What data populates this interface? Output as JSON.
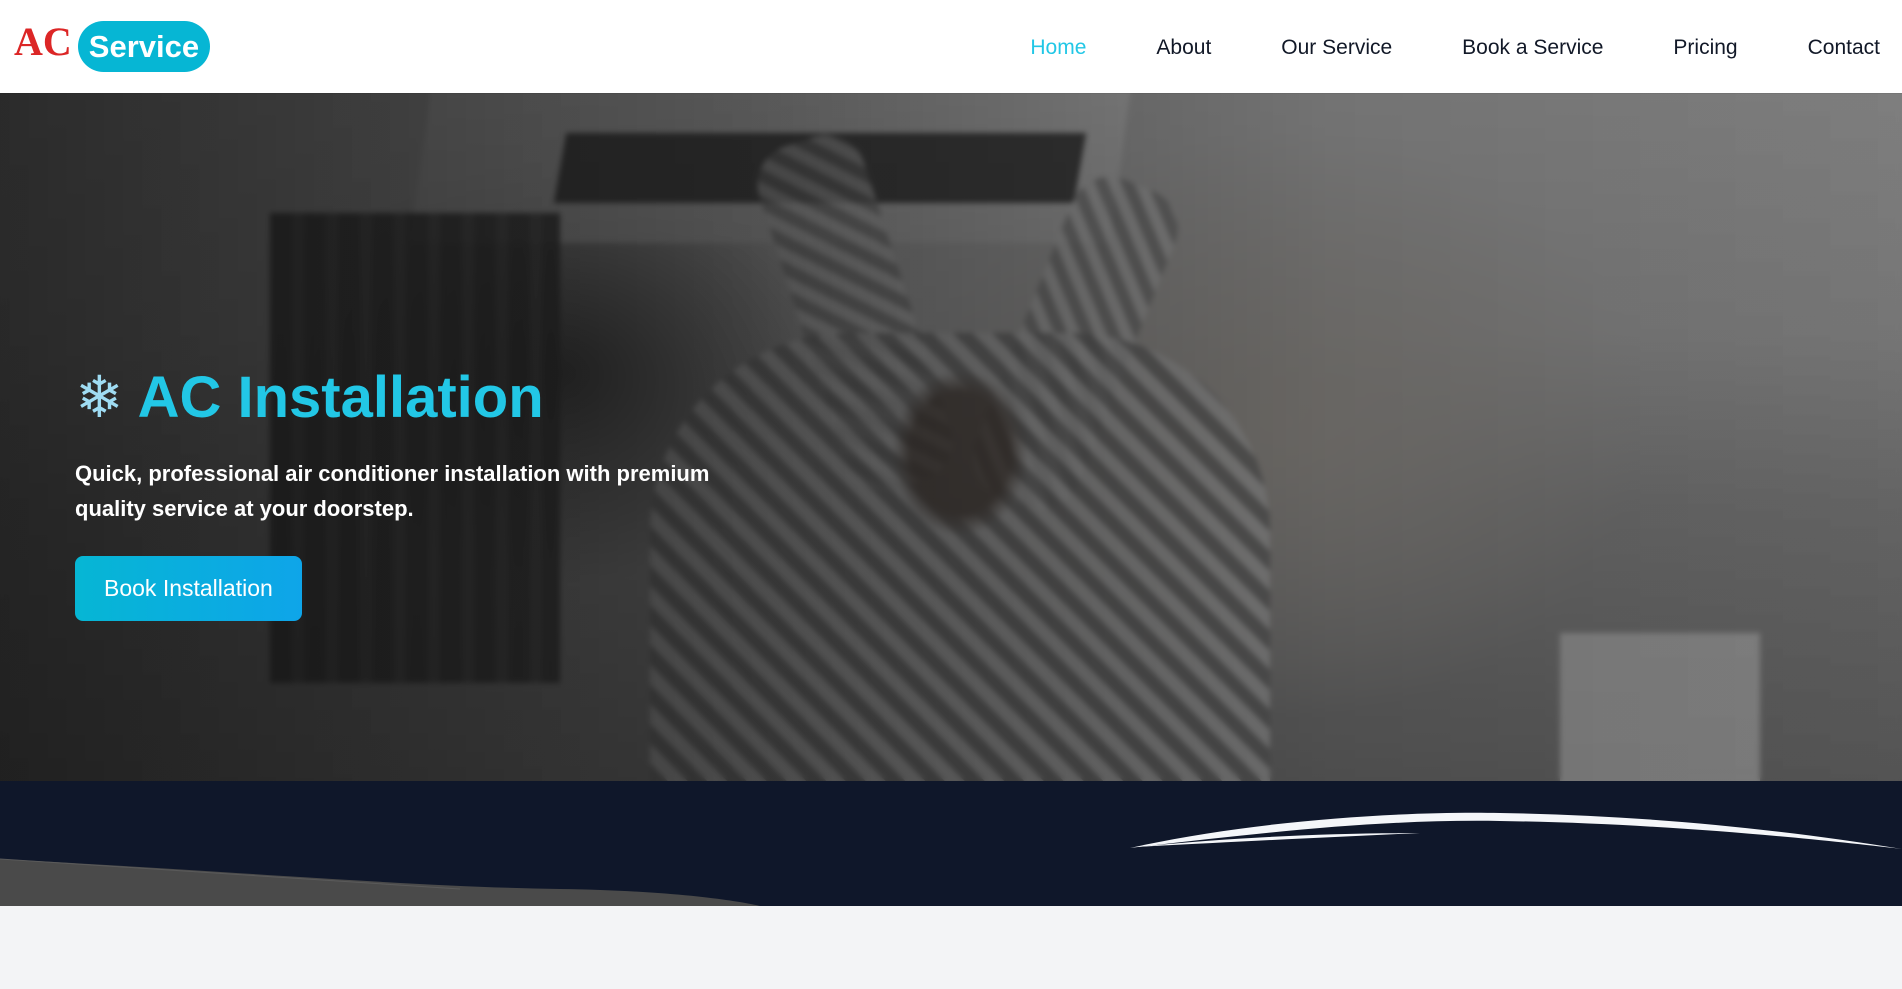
{
  "logo": {
    "ac_text": "AC",
    "service_text": "Service"
  },
  "nav": {
    "items": [
      {
        "label": "Home",
        "active": true
      },
      {
        "label": "About",
        "active": false
      },
      {
        "label": "Our Service",
        "active": false
      },
      {
        "label": "Book a Service",
        "active": false
      },
      {
        "label": "Pricing",
        "active": false
      },
      {
        "label": "Contact",
        "active": false
      }
    ]
  },
  "hero": {
    "icon": "snowflake-icon",
    "title": "AC Installation",
    "subtitle": "Quick, professional air conditioner installation with premium quality service at your doorstep.",
    "button_label": "Book Installation"
  },
  "colors": {
    "accent": "#22c7e6",
    "logo_red": "#dc2626",
    "logo_pill": "#06b6d4",
    "button": "#0ea5e9",
    "navy": "#0f172a",
    "page_bg": "#f3f4f6"
  }
}
